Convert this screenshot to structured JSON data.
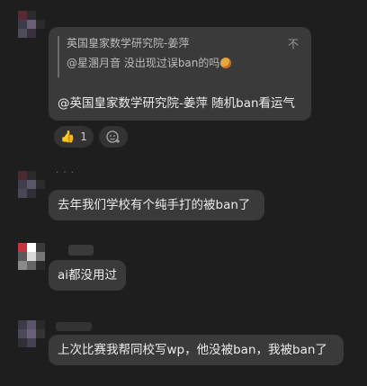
{
  "messages": [
    {
      "quote": {
        "author": "英国皇家数学研究院-姜萍",
        "close": "不",
        "text": "@星溷月音 没出现过误ban的吗"
      },
      "text": "@英国皇家数学研究院-姜萍 随机ban看运气",
      "reactions": [
        {
          "icon": "thumbs-up",
          "count": "1"
        },
        {
          "icon": "add-reaction",
          "count": ""
        }
      ]
    },
    {
      "text": "去年我们学校有个纯手打的被ban了"
    },
    {
      "text": "ai都没用过"
    },
    {
      "text": "上次比赛我帮同校写wp，他没被ban，我被ban了"
    }
  ],
  "colors": {
    "background": "#1e1e1e",
    "bubble": "#3a3a3a"
  }
}
